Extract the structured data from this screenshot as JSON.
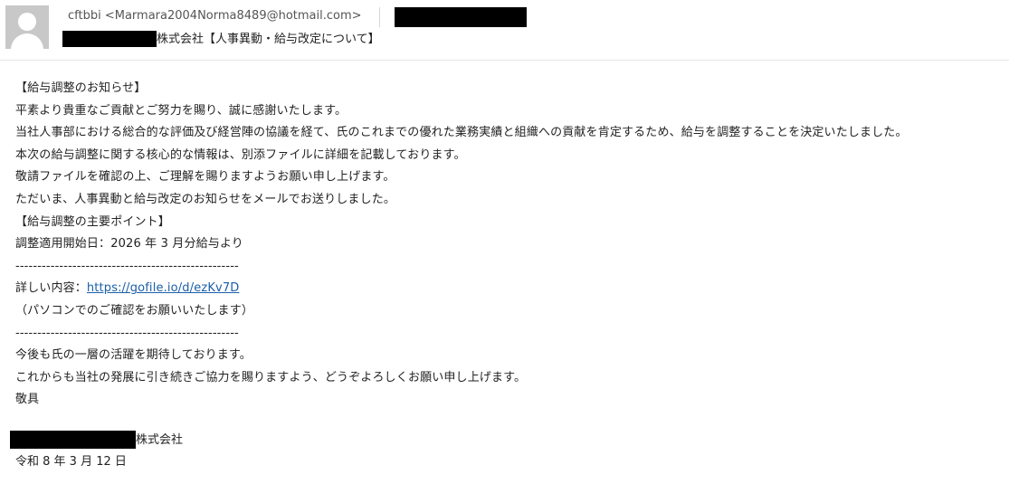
{
  "header": {
    "sender_name": "cftbbi",
    "sender_email": "<Marmara2004Norma8489@hotmail.com>",
    "subject": "株式会社【人事異動・給与改定について】"
  },
  "body": {
    "lines": [
      "【給与調整のお知らせ】",
      "平素より貴重なご貢献とご努力を賜り、誠に感謝いたします。",
      "当社人事部における総合的な評価及び経営陣の協議を経て、氏のこれまでの優れた業務実績と組織への貢献を肯定するため、給与を調整することを決定いたしました。",
      "本次の給与調整に関する核心的な情報は、別添ファイルに詳細を記載しております。",
      "敬請ファイルを確認の上、ご理解を賜りますようお願い申し上げます。",
      "ただいま、人事異動と給与改定のお知らせをメールでお送りしました。",
      "【給与調整の主要ポイント】",
      "調整適用開始日：2026 年 3 月分給与より",
      "---------------------------------------------------",
      "",
      "（パソコンでのご確認をお願いいたします）",
      "---------------------------------------------------",
      "今後も氏の一層の活躍を期待しております。",
      "これからも当社の発展に引き続きご協力を賜りますよう、どうぞよろしくお願い申し上げます。",
      "敬具"
    ],
    "details_label": "詳しい内容：",
    "details_link": "https://gofile.io/d/ezKv7D"
  },
  "signature": {
    "company_suffix": "株式会社",
    "date": "令和 8 年 3 月 12 日"
  }
}
